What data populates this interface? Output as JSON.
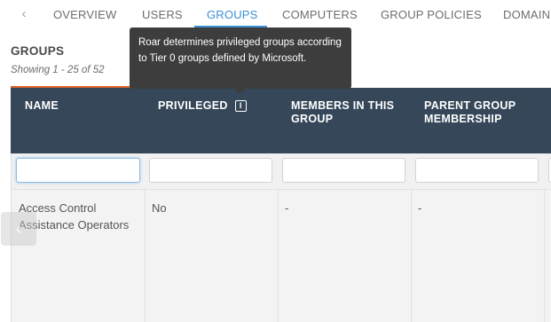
{
  "tabs": {
    "back_glyph": "‹",
    "items": [
      "OVERVIEW",
      "USERS",
      "GROUPS",
      "COMPUTERS",
      "GROUP POLICIES",
      "DOMAIN"
    ],
    "active": "GROUPS"
  },
  "page": {
    "title": "GROUPS",
    "showing": "Showing 1 - 25 of 52"
  },
  "table": {
    "columns": [
      "NAME",
      "PRIVILEGED",
      "MEMBERS IN THIS GROUP",
      "PARENT GROUP MEMBERSHIP"
    ],
    "info_icon_glyph": "i",
    "filters": {
      "name": "",
      "privileged": "",
      "members": "",
      "parent": ""
    },
    "rows": [
      {
        "name": "Access Control Assistance Operators",
        "privileged": "No",
        "members": "-",
        "parent": "-"
      }
    ]
  },
  "tooltip": {
    "text": "Roar determines privileged groups according to Tier 0 groups defined by Microsoft."
  },
  "float_back_glyph": "‹",
  "colors": {
    "accent": "#3d8fd6",
    "header_bg": "#354759",
    "orange_bar": "#e0622b",
    "tooltip_bg": "#3d3d3d"
  }
}
